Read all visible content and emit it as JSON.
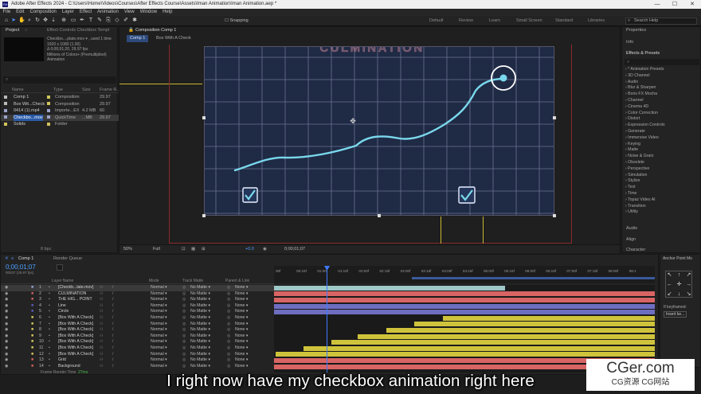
{
  "titlebar": {
    "app_logo": "Ae",
    "text": "Adobe After Effects 2024 - C:\\Users\\Home\\Videos\\Courses\\After Effects Course\\Assets\\Iman Animation\\Iman Animation.aep *",
    "minimize": "—",
    "maximize": "☐",
    "close": "✕"
  },
  "menu": [
    "File",
    "Edit",
    "Composition",
    "Layer",
    "Effect",
    "Animation",
    "View",
    "Window",
    "Help"
  ],
  "toolbar": {
    "snapping": "Snapping",
    "workspaces": [
      "Default",
      "Review",
      "Learn",
      "Small Screen",
      "Standard",
      "Libraries"
    ],
    "search": "Search Help"
  },
  "project": {
    "tab": "Project",
    "effect_controls": "Effect Controls Checkbox Templ",
    "info": [
      "Checkbo....plate.mov ▾ , used 1 time",
      "1920 x 1080 (1.00)",
      "Δ 0;00;01;20, 29.97 fps",
      "Millions of Colors+ (Premultiplied)",
      "Animation"
    ],
    "search_icon": "⌕",
    "headers": {
      "name": "Name",
      "type": "Type",
      "size": "Size",
      "rate": "Frame R..."
    },
    "items": [
      {
        "name": "Comp 1",
        "type": "Composition",
        "size": "",
        "rate": "29.97",
        "color": "#d2c45c"
      },
      {
        "name": "Box Wit...Check",
        "type": "Composition",
        "size": "",
        "rate": "29.97",
        "color": "#d2c45c"
      },
      {
        "name": "0414 (1).mp4",
        "type": "Importe...EX",
        "size": "4.2 MB",
        "rate": "60",
        "color": "#9aa3c9"
      },
      {
        "name": "Checkbo...mov",
        "type": "QuickTime",
        "size": "...MB",
        "rate": "29.97",
        "color": "#9aa3c9"
      },
      {
        "name": "Solids",
        "type": "Folder",
        "size": "",
        "rate": "",
        "color": "#d2c45c"
      }
    ],
    "footer": "8 bpc"
  },
  "composition": {
    "tab": "Composition Comp 1",
    "crumbs": [
      "Comp 1",
      "Box With A Check"
    ],
    "title_text": "CULMINATION",
    "zoom": "50%",
    "quality": "Full",
    "exposure": "+0.0",
    "timecode": "0;00;01;07"
  },
  "right": {
    "properties": "Properties",
    "info": "Info",
    "effects_title": "Effects & Presets",
    "search_icon": "⌕",
    "effects": [
      "* Animation Presets",
      "3D Channel",
      "Audio",
      "Blur & Sharpen",
      "Boris FX Mocha",
      "Channel",
      "Cinema 4D",
      "Color Correction",
      "Distort",
      "Expression Controls",
      "Generate",
      "Immersive Video",
      "Keying",
      "Matte",
      "Noise & Grain",
      "Obsolete",
      "Perspective",
      "Simulation",
      "Stylize",
      "Text",
      "Time",
      "Topaz Video AI",
      "Transition",
      "Utility"
    ],
    "audio": "Audio",
    "align": "Align",
    "character": "Character"
  },
  "anchor": {
    "title": "Anchor Point Mo",
    "if_keyframed": "If keyframed:",
    "insert_key": "Insert ke..."
  },
  "timeline": {
    "tab": "Comp 1",
    "render_queue": "Render Queue",
    "timecode": "0;00;01;07",
    "fps": "00037 (29.97 fps)",
    "headers": {
      "layer": "Layer Name",
      "mode": "Mode",
      "trkmat": "Track Matte",
      "parent": "Parent & Link"
    },
    "ticks": [
      "00f",
      "00:15f",
      "01:00f",
      "01:15f",
      "02:00f",
      "02:15f",
      "03:00f",
      "03:15f",
      "04:00f",
      "04:15f",
      "05:00f",
      "05:15f",
      "06:00f",
      "06:15f",
      "07:00f",
      "07:15f",
      "08:00f",
      "08:1"
    ],
    "layers": [
      {
        "num": "1",
        "name": "[Checkb...late.mov]",
        "color": "#8ea3c9"
      },
      {
        "num": "2",
        "name": "CULMINATION",
        "color": "#d05f5f"
      },
      {
        "num": "3",
        "name": "THE HIG... POINT",
        "color": "#d05f5f"
      },
      {
        "num": "4",
        "name": "Line",
        "color": "#5a5ab8"
      },
      {
        "num": "5",
        "name": "Circle",
        "color": "#5a5ab8"
      },
      {
        "num": "6",
        "name": "[Box With A Check]",
        "color": "#d2c45c"
      },
      {
        "num": "7",
        "name": "[Box With A Check]",
        "color": "#d2c45c"
      },
      {
        "num": "8",
        "name": "[Box With A Check]",
        "color": "#d2c45c"
      },
      {
        "num": "9",
        "name": "[Box With A Check]",
        "color": "#d2c45c"
      },
      {
        "num": "10",
        "name": "[Box With A Check]",
        "color": "#d2c45c"
      },
      {
        "num": "11",
        "name": "[Box With A Check]",
        "color": "#d2c45c"
      },
      {
        "num": "12",
        "name": "[Box With A Check]",
        "color": "#d2c45c"
      },
      {
        "num": "13",
        "name": "Grid",
        "color": "#d05f5f"
      },
      {
        "num": "14",
        "name": "Background",
        "color": "#d05f5f"
      }
    ],
    "mode_value": "Normal",
    "trkmat_value": "No Matte",
    "parent_value": "None",
    "footer_label": "Frame Render Time",
    "footer_value": "27ms"
  },
  "subtitle": "I right now have my checkbox animation right here",
  "watermark": {
    "main": "CGer.com",
    "sub": "CG资源 CG网站"
  }
}
